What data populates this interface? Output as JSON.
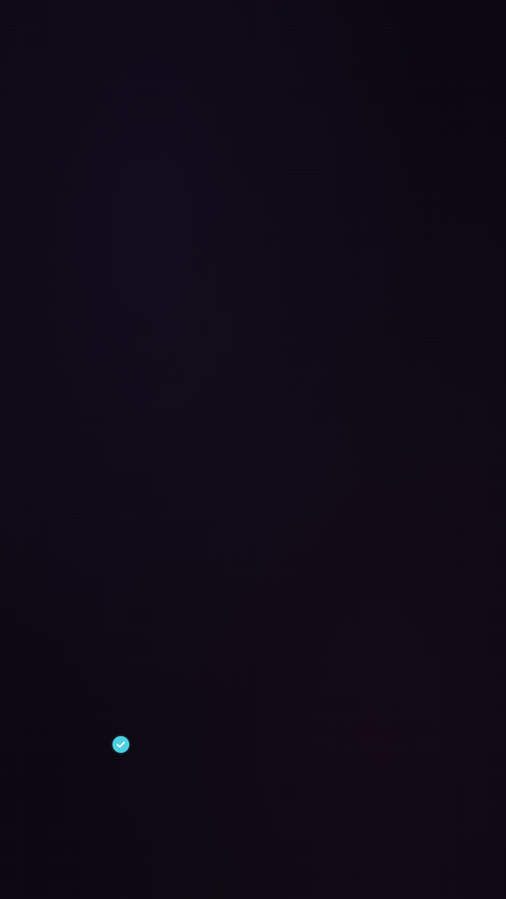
{
  "screen": {
    "view": "camera-viewfinder",
    "background_color": "#0b0712"
  },
  "focus_indicator": {
    "icon": "check-circle-icon",
    "color": "#4dd0e1",
    "check_color": "#ffffff"
  }
}
